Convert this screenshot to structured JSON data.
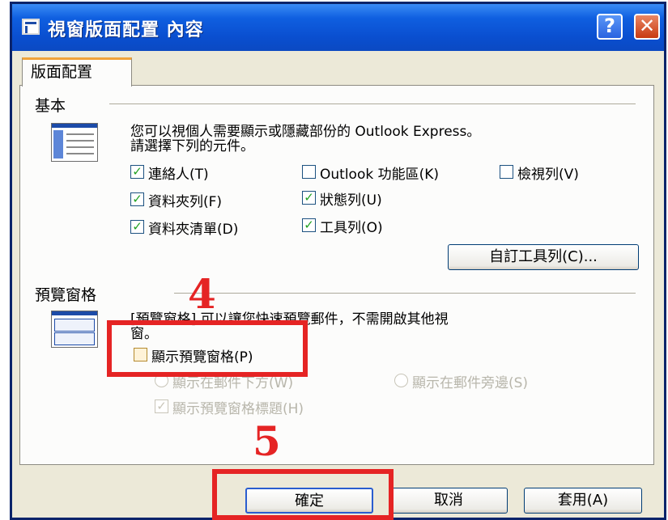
{
  "window": {
    "title": "視窗版面配置 內容",
    "help_label": "?",
    "close_label": "✕",
    "icon": "window-layout-icon"
  },
  "tab": {
    "label": "版面配置"
  },
  "basic": {
    "heading": "基本",
    "icon": "layout-icon",
    "description_line1": "您可以視個人需要顯示或隱藏部份的 Outlook Express。",
    "description_line2": "請選擇下列的元件。",
    "checkboxes": [
      {
        "label": "連絡人(T)",
        "checked": true
      },
      {
        "label": "Outlook 功能區(K)",
        "checked": false
      },
      {
        "label": "檢視列(V)",
        "checked": false
      },
      {
        "label": "資料夾列(F)",
        "checked": true
      },
      {
        "label": "狀態列(U)",
        "checked": true
      },
      {
        "label": "資料夾清單(D)",
        "checked": true
      },
      {
        "label": "工具列(O)",
        "checked": true
      }
    ],
    "customize_button": "自訂工具列(C)..."
  },
  "preview": {
    "heading": "預覽窗格",
    "icon": "preview-pane-icon",
    "description_line1": "[預覽窗格] 可以讓您快速預覽郵件，不需開啟其他視",
    "description_line2": "窗。",
    "show_preview_label": "顯示預覽窗格(P)",
    "show_preview_checked": false,
    "below_label": "顯示在郵件下方(W)",
    "beside_label": "顯示在郵件旁邊(S)",
    "show_header_label": "顯示預覽窗格標題(H)",
    "show_header_checked": true
  },
  "footer": {
    "ok_label": "確定",
    "cancel_label": "取消",
    "apply_label": "套用(A)"
  },
  "annotations": {
    "step4": "4",
    "step5": "5"
  },
  "colors": {
    "titlebar": "#0a4fd0",
    "annotation": "#e52424",
    "check": "#21a121"
  }
}
